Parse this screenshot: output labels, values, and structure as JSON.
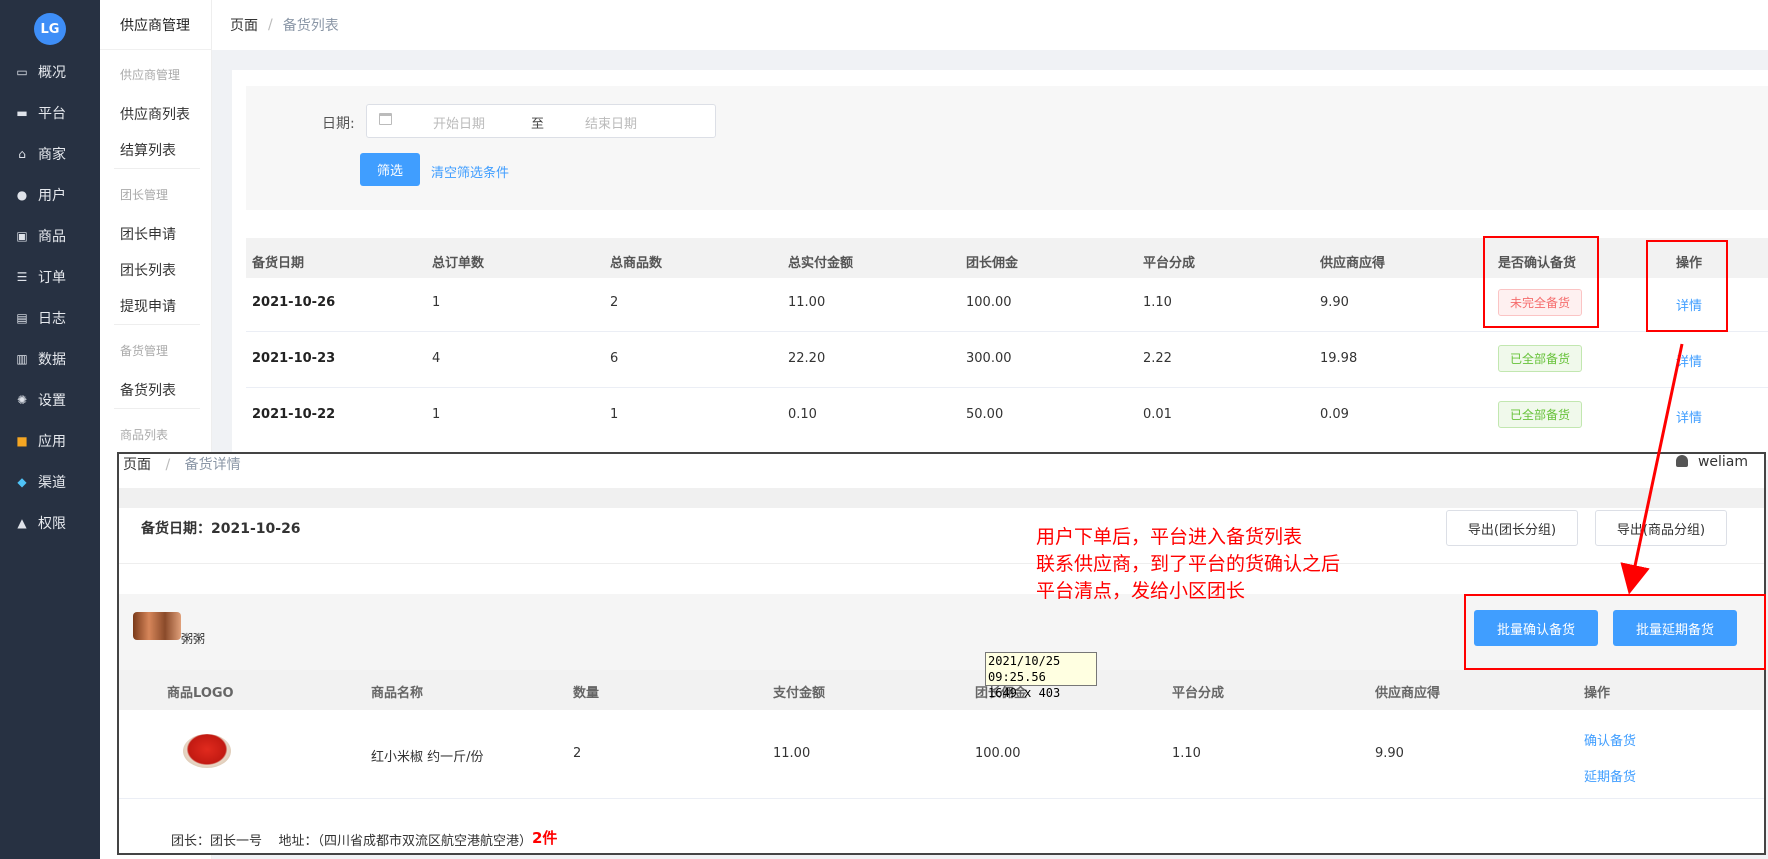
{
  "nav": {
    "logo": "LG",
    "items": [
      "概况",
      "平台",
      "商家",
      "用户",
      "商品",
      "订单",
      "日志",
      "数据",
      "设置",
      "应用",
      "渠道",
      "权限"
    ]
  },
  "subnav": {
    "title": "供应商管理",
    "groups": [
      {
        "title": "供应商管理",
        "items": [
          "供应商列表",
          "结算列表"
        ]
      },
      {
        "title": "团长管理",
        "items": [
          "团长申请",
          "团长列表",
          "提现申请"
        ]
      },
      {
        "title": "备货管理",
        "items": [
          "备货列表"
        ]
      },
      {
        "title": "商品列表",
        "items": []
      }
    ]
  },
  "breadcrumb": {
    "root": "页面",
    "sep": "/",
    "current": "备货列表"
  },
  "filter": {
    "label": "日期:",
    "start_placeholder": "开始日期",
    "range_sep": "至",
    "end_placeholder": "结束日期",
    "filter_button": "筛选",
    "clear_link": "清空筛选条件"
  },
  "table": {
    "headers": [
      "备货日期",
      "总订单数",
      "总商品数",
      "总实付金额",
      "团长佣金",
      "平台分成",
      "供应商应得",
      "是否确认备货",
      "操作"
    ],
    "rows": [
      {
        "date": "2021-10-26",
        "orders": "1",
        "goods": "2",
        "paid": "11.00",
        "commission": "100.00",
        "platform": "1.10",
        "supplier": "9.90",
        "status": "未完全备货",
        "action": "详情"
      },
      {
        "date": "2021-10-23",
        "orders": "4",
        "goods": "6",
        "paid": "22.20",
        "commission": "300.00",
        "platform": "2.22",
        "supplier": "19.98",
        "status": "已全部备货",
        "action": "详情"
      },
      {
        "date": "2021-10-22",
        "orders": "1",
        "goods": "1",
        "paid": "0.10",
        "commission": "50.00",
        "platform": "0.01",
        "supplier": "0.09",
        "status": "已全部备货",
        "action": "详情"
      }
    ]
  },
  "detail": {
    "breadcrumb": {
      "root": "页面",
      "sep": "/",
      "current": "备货详情"
    },
    "user": "weliam",
    "date_label": "备货日期：2021-10-26",
    "export_leader": "导出(团长分组)",
    "export_goods": "导出(商品分组)",
    "batch_confirm": "批量确认备货",
    "batch_delay": "批量延期备货",
    "group_name": "粥粥",
    "headers": [
      "商品LOGO",
      "商品名称",
      "数量",
      "支付金额",
      "团长佣金",
      "平台分成",
      "供应商应得",
      "操作"
    ],
    "row": {
      "name": "红小米椒 约一斤/份",
      "qty": "2",
      "paid": "11.00",
      "commission": "100.00",
      "platform": "1.10",
      "supplier": "9.90",
      "confirm": "确认备货",
      "delay": "延期备货"
    },
    "footer": "团长：团长一号    地址：（四川省成都市双流区航空港航空港）",
    "count": "2件"
  },
  "tooltip": {
    "line1": "2021/10/25 09:25.56",
    "line2": "1649 x 403"
  },
  "annotation": {
    "line1": "用户下单后，平台进入备货列表",
    "line2": "联系供应商，到了平台的货确认之后",
    "line3": "平台清点，发给小区团长"
  },
  "colors": {
    "sidebar": "#273142",
    "primary": "#409eff",
    "annotation": "#ff0000"
  }
}
